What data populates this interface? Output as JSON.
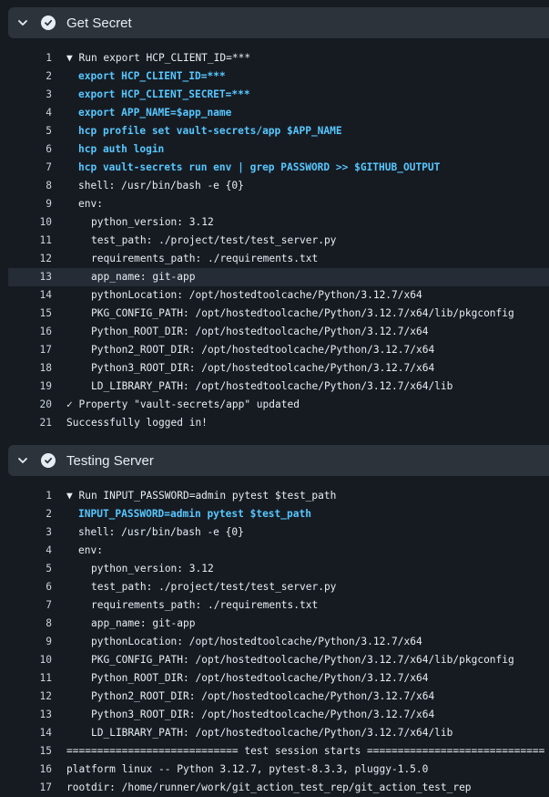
{
  "steps": [
    {
      "title": "Get Secret",
      "lines": [
        {
          "n": "1",
          "text": "▼ Run export HCP_CLIENT_ID=***"
        },
        {
          "n": "2",
          "text": "export HCP_CLIENT_ID=***"
        },
        {
          "n": "3",
          "text": "export HCP_CLIENT_SECRET=***"
        },
        {
          "n": "4",
          "text": "export APP_NAME=$app_name"
        },
        {
          "n": "5",
          "text": "hcp profile set vault-secrets/app $APP_NAME"
        },
        {
          "n": "6",
          "text": "hcp auth login"
        },
        {
          "n": "7",
          "text": "hcp vault-secrets run env | grep PASSWORD >> $GITHUB_OUTPUT"
        },
        {
          "n": "8",
          "text": "shell: /usr/bin/bash -e {0}"
        },
        {
          "n": "9",
          "text": "env:"
        },
        {
          "n": "10",
          "text": "python_version: 3.12"
        },
        {
          "n": "11",
          "text": "test_path: ./project/test/test_server.py"
        },
        {
          "n": "12",
          "text": "requirements_path: ./requirements.txt"
        },
        {
          "n": "13",
          "text": "app_name: git-app"
        },
        {
          "n": "14",
          "text": "pythonLocation: /opt/hostedtoolcache/Python/3.12.7/x64"
        },
        {
          "n": "15",
          "text": "PKG_CONFIG_PATH: /opt/hostedtoolcache/Python/3.12.7/x64/lib/pkgconfig"
        },
        {
          "n": "16",
          "text": "Python_ROOT_DIR: /opt/hostedtoolcache/Python/3.12.7/x64"
        },
        {
          "n": "17",
          "text": "Python2_ROOT_DIR: /opt/hostedtoolcache/Python/3.12.7/x64"
        },
        {
          "n": "18",
          "text": "Python3_ROOT_DIR: /opt/hostedtoolcache/Python/3.12.7/x64"
        },
        {
          "n": "19",
          "text": "LD_LIBRARY_PATH: /opt/hostedtoolcache/Python/3.12.7/x64/lib"
        },
        {
          "n": "20",
          "text": "✓ Property \"vault-secrets/app\" updated"
        },
        {
          "n": "21",
          "text": "Successfully logged in!"
        }
      ]
    },
    {
      "title": "Testing Server",
      "lines": [
        {
          "n": "1",
          "text": "▼ Run INPUT_PASSWORD=admin pytest $test_path"
        },
        {
          "n": "2",
          "text": "INPUT_PASSWORD=admin pytest $test_path"
        },
        {
          "n": "3",
          "text": "shell: /usr/bin/bash -e {0}"
        },
        {
          "n": "4",
          "text": "env:"
        },
        {
          "n": "5",
          "text": "python_version: 3.12"
        },
        {
          "n": "6",
          "text": "test_path: ./project/test/test_server.py"
        },
        {
          "n": "7",
          "text": "requirements_path: ./requirements.txt"
        },
        {
          "n": "8",
          "text": "app_name: git-app"
        },
        {
          "n": "9",
          "text": "pythonLocation: /opt/hostedtoolcache/Python/3.12.7/x64"
        },
        {
          "n": "10",
          "text": "PKG_CONFIG_PATH: /opt/hostedtoolcache/Python/3.12.7/x64/lib/pkgconfig"
        },
        {
          "n": "11",
          "text": "Python_ROOT_DIR: /opt/hostedtoolcache/Python/3.12.7/x64"
        },
        {
          "n": "12",
          "text": "Python2_ROOT_DIR: /opt/hostedtoolcache/Python/3.12.7/x64"
        },
        {
          "n": "13",
          "text": "Python3_ROOT_DIR: /opt/hostedtoolcache/Python/3.12.7/x64"
        },
        {
          "n": "14",
          "text": "LD_LIBRARY_PATH: /opt/hostedtoolcache/Python/3.12.7/x64/lib"
        },
        {
          "n": "15",
          "text": "============================ test session starts ============================="
        },
        {
          "n": "16",
          "text": "platform linux -- Python 3.12.7, pytest-8.3.3, pluggy-1.5.0"
        },
        {
          "n": "17",
          "text": "rootdir: /home/runner/work/git_action_test_rep/git_action_test_rep"
        }
      ]
    }
  ],
  "icons": {
    "collapse": "chevron-down-icon",
    "status": "check-circle-icon"
  },
  "colors": {
    "background": "#161b22",
    "header": "#2d333b",
    "command": "#57c7ff",
    "highlight_row": "#262c36"
  }
}
